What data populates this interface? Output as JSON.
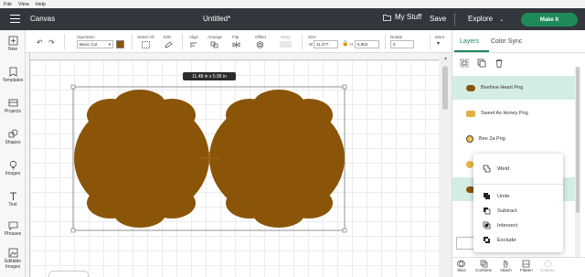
{
  "menubar": {
    "items": [
      "File",
      "View",
      "Help"
    ]
  },
  "header": {
    "canvas_label": "Canvas",
    "document_title": "Untitled*",
    "my_stuff": "My Stuff",
    "save": "Save",
    "explore": "Explore",
    "make_it": "Make It"
  },
  "sidebar": {
    "items": [
      "New",
      "Templates",
      "Projects",
      "Shapes",
      "Images",
      "Text",
      "Phrases",
      "Editable Images"
    ]
  },
  "toolbar": {
    "operation_label": "Operation",
    "operation_value": "Basic Cut",
    "select_all": "Select All",
    "edit": "Edit",
    "align": "Align",
    "arrange": "Arrange",
    "flip": "Flip",
    "offset": "Offset",
    "warp": "Warp",
    "size_label": "Size",
    "width_prefix": "W",
    "width_value": "11.477",
    "height_prefix": "H",
    "height_value": "5.952",
    "rotate_label": "Rotate",
    "rotate_value": "0",
    "more": "More",
    "fill_color": "#8a5508"
  },
  "canvas": {
    "size_tag": "11.48  in x 5.95  in",
    "shape_color": "#8a5508"
  },
  "panel": {
    "tabs": [
      "Layers",
      "Color Sync"
    ],
    "layers": [
      {
        "name": "Beehive Heart Png",
        "selected": true
      },
      {
        "name": "Sweet As Honey Png",
        "selected": false
      },
      {
        "name": "Bee 2a Png",
        "selected": false
      }
    ],
    "actions": [
      "Slice",
      "Combine",
      "Attach",
      "Flatten",
      "Contour"
    ]
  },
  "dropdown": {
    "items": [
      "Weld",
      "Unite",
      "Subtract",
      "Intersect",
      "Exclude"
    ]
  },
  "colors": {
    "topbar": "#31373c",
    "accent": "#1d8a57",
    "selected_row": "#d4ede3"
  }
}
